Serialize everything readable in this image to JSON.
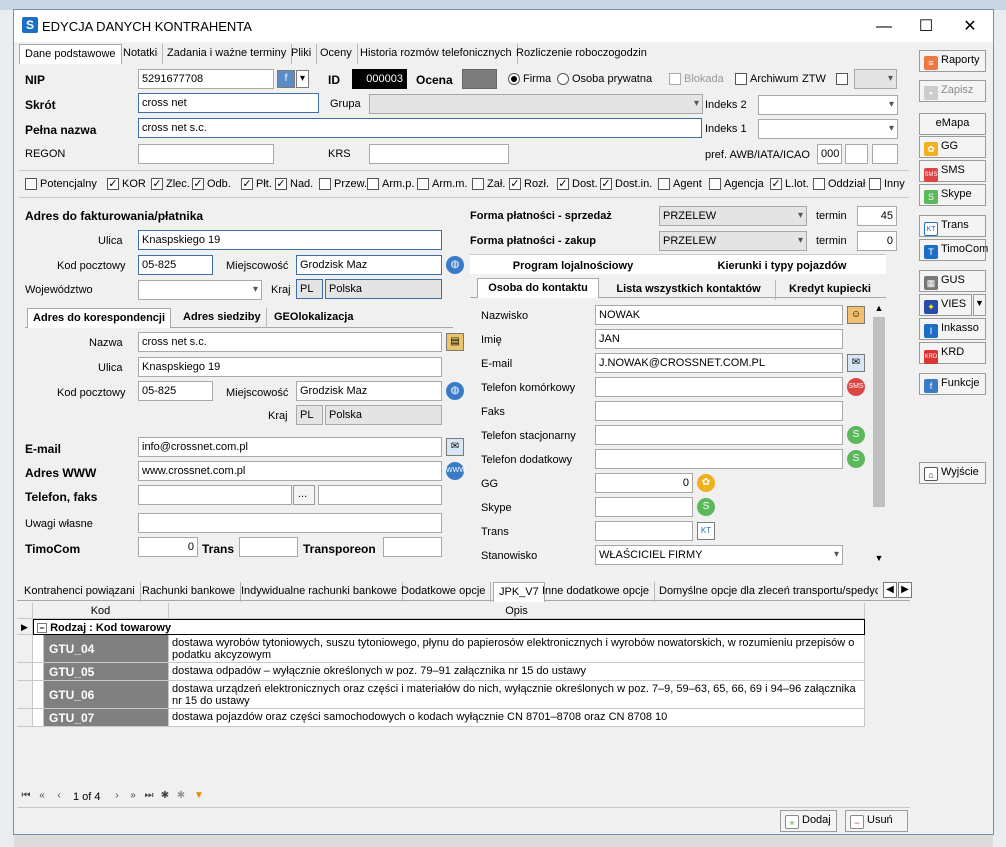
{
  "window": {
    "title": "EDYCJA DANYCH KONTRAHENTA",
    "minimize": "—",
    "maximize": "☐",
    "close": "✕"
  },
  "tabs": [
    "Dane podstawowe",
    "Notatki",
    "Zadania i ważne terminy",
    "Pliki",
    "Oceny",
    "Historia rozmów telefonicznych",
    "Rozliczenie roboczogodzin"
  ],
  "form": {
    "nip_label": "NIP",
    "nip": "5291677708",
    "id_label": "ID",
    "id": "000003",
    "ocena_label": "Ocena",
    "firma": "Firma",
    "osoba": "Osoba prywatna",
    "blokada": "Blokada",
    "archiwum": "Archiwum",
    "ztw": "ZTW",
    "skrot_label": "Skrót",
    "skrot": "cross net",
    "grupa_label": "Grupa",
    "indeks2_label": "Indeks 2",
    "indeks1_label": "Indeks 1",
    "pelna_label": "Pełna nazwa",
    "pelna": "cross net s.c.",
    "regon_label": "REGON",
    "krs_label": "KRS",
    "pref_label": "pref. AWB/IATA/ICAO",
    "pref": "000"
  },
  "checkboxes": [
    {
      "label": "Potencjalny",
      "checked": false
    },
    {
      "label": "KOR",
      "checked": true
    },
    {
      "label": "Zlec.",
      "checked": true
    },
    {
      "label": "Odb.",
      "checked": true
    },
    {
      "label": "Płt.",
      "checked": true
    },
    {
      "label": "Nad.",
      "checked": true
    },
    {
      "label": "Przew.",
      "checked": false
    },
    {
      "label": "Arm.p.",
      "checked": false
    },
    {
      "label": "Arm.m.",
      "checked": false
    },
    {
      "label": "Zał.",
      "checked": false
    },
    {
      "label": "Rozł.",
      "checked": true
    },
    {
      "label": "Dost.",
      "checked": true
    },
    {
      "label": "Dost.in.",
      "checked": true
    },
    {
      "label": "Agent",
      "checked": false
    },
    {
      "label": "Agencja",
      "checked": false
    },
    {
      "label": "L.lot.",
      "checked": true
    },
    {
      "label": "Oddział",
      "checked": false
    },
    {
      "label": "Inny",
      "checked": false
    }
  ],
  "billing": {
    "header": "Adres do fakturowania/płatnika",
    "ulica_label": "Ulica",
    "ulica": "Knaspskiego 19",
    "kod_label": "Kod pocztowy",
    "kod": "05-825",
    "miejsc_label": "Miejscowość",
    "miejsc": "Grodzisk Maz",
    "woj_label": "Województwo",
    "kraj_label": "Kraj",
    "kraj_code": "PL",
    "kraj": "Polska"
  },
  "payment": {
    "sprzedaz_label": "Forma płatności - sprzedaż",
    "sprzedaz": "PRZELEW",
    "termin_label": "termin",
    "termin_s": "45",
    "zakup_label": "Forma płatności - zakup",
    "zakup": "PRZELEW",
    "termin_z": "0"
  },
  "addr_tabs": [
    "Adres do korespondencji",
    "Adres siedziby",
    "GEOlokalizacja"
  ],
  "corr": {
    "nazwa_label": "Nazwa",
    "nazwa": "cross net s.c.",
    "ulica_label": "Ulica",
    "ulica": "Knaspskiego 19",
    "kod_label": "Kod pocztowy",
    "kod": "05-825",
    "miejsc_label": "Miejscowość",
    "miejsc": "Grodzisk Maz",
    "kraj_label": "Kraj",
    "kraj_code": "PL",
    "kraj": "Polska"
  },
  "contact": {
    "email_label": "E-mail",
    "email": "info@crossnet.com.pl",
    "www_label": "Adres WWW",
    "www": "www.crossnet.com.pl",
    "tel_label": "Telefon, faks",
    "tel_btn": "...",
    "uwagi_label": "Uwagi własne",
    "timocom_label": "TimoCom",
    "timocom": "0",
    "trans_label": "Trans",
    "transporeon_label": "Transporeon"
  },
  "right_tabs_top": [
    "Program lojalnościowy",
    "Kierunki i typy pojazdów"
  ],
  "right_tabs": [
    "Osoba do kontaktu",
    "Lista wszystkich kontaktów",
    "Kredyt kupiecki"
  ],
  "person": {
    "nazwisko_label": "Nazwisko",
    "nazwisko": "NOWAK",
    "imie_label": "Imię",
    "imie": "JAN",
    "email_label": "E-mail",
    "email": "J.NOWAK@CROSSNET.COM.PL",
    "kom_label": "Telefon komórkowy",
    "faks_label": "Faks",
    "stac_label": "Telefon stacjonarny",
    "dod_label": "Telefon dodatkowy",
    "gg_label": "GG",
    "gg": "0",
    "skype_label": "Skype",
    "trans_label": "Trans",
    "stan_label": "Stanowisko",
    "stan": "WŁAŚCICIEL FIRMY"
  },
  "sidebar": {
    "raporty": "Raporty",
    "zapisz": "Zapisz",
    "emapa": "eMapa",
    "gg": "GG",
    "sms": "SMS",
    "skype": "Skype",
    "trans": "Trans",
    "timocom": "TimoCom",
    "gus": "GUS",
    "vies": "VIES",
    "inkasso": "Inkasso",
    "krd": "KRD",
    "funkcje": "Funkcje",
    "wyjscie": "Wyjście"
  },
  "bottom_tabs": [
    "Kontrahenci powiązani",
    "Rachunki bankowe",
    "Indywidualne rachunki bankowe",
    "Dodatkowe opcje",
    "JPK_V7",
    "Inne dodatkowe opcje",
    "Domyślne opcje dla zleceń transportu/spedyc"
  ],
  "grid": {
    "col_kod": "Kod",
    "col_opis": "Opis",
    "group": "Rodzaj : Kod towarowy",
    "rows": [
      {
        "kod": "GTU_04",
        "opis": "dostawa wyrobów tytoniowych, suszu tytoniowego, płynu do papierosów elektronicznych i wyrobów nowatorskich, w rozumieniu przepisów o podatku akcyzowym"
      },
      {
        "kod": "GTU_05",
        "opis": "dostawa odpadów – wyłącznie określonych w poz. 79–91 załącznika nr 15 do ustawy"
      },
      {
        "kod": "GTU_06",
        "opis": "dostawa urządzeń elektronicznych oraz części i materiałów do nich, wyłącznie określonych w poz. 7–9, 59–63, 65, 66, 69 i 94–96 załącznika nr 15 do ustawy"
      },
      {
        "kod": "GTU_07",
        "opis": "dostawa pojazdów oraz części samochodowych o kodach wyłącznie CN 8701–8708 oraz CN 8708 10"
      }
    ]
  },
  "pager": {
    "text": "1 of 4"
  },
  "buttons": {
    "dodaj": "Dodaj",
    "usun": "Usuń"
  },
  "colors": {
    "blue_border": "#3d6ea8",
    "code_cell": "#808080"
  }
}
